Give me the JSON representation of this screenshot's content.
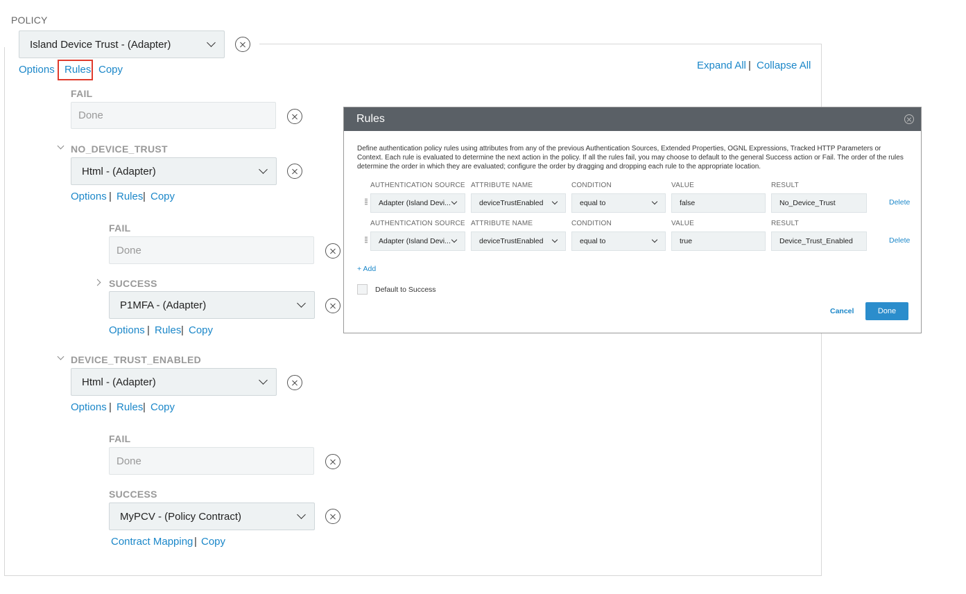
{
  "policy_label": "POLICY",
  "root": {
    "select": "Island Device Trust - (Adapter)",
    "links": {
      "options": "Options",
      "rules": "Rules",
      "copy": "Copy"
    },
    "expand_all": "Expand All",
    "sep": "|",
    "collapse_all": "Collapse All"
  },
  "fail1": {
    "label": "FAIL",
    "value": "Done"
  },
  "no_device_trust": {
    "label": "NO_DEVICE_TRUST",
    "select": "Html - (Adapter)",
    "links": {
      "options": "Options",
      "rules": "Rules",
      "copy": "Copy"
    },
    "fail": {
      "label": "FAIL",
      "value": "Done"
    },
    "success": {
      "label": "SUCCESS",
      "select": "P1MFA - (Adapter)",
      "links": {
        "options": "Options",
        "rules": "Rules",
        "copy": "Copy"
      }
    }
  },
  "device_trust_enabled": {
    "label": "DEVICE_TRUST_ENABLED",
    "select": "Html - (Adapter)",
    "links": {
      "options": "Options",
      "rules": "Rules",
      "copy": "Copy"
    },
    "fail": {
      "label": "FAIL",
      "value": "Done"
    },
    "success": {
      "label": "SUCCESS",
      "select": "MyPCV - (Policy Contract)",
      "links": {
        "contract_mapping": "Contract Mapping",
        "copy": "Copy"
      }
    }
  },
  "modal": {
    "title": "Rules",
    "description": "Define authentication policy rules using attributes from any of the previous Authentication Sources, Extended Properties, OGNL Expressions, Tracked HTTP Parameters or Context. Each rule is evaluated to determine the next action in the policy. If all the rules fail, you may choose to default to the general Success action or Fail. The order of the rules determine the order in which they are evaluated; configure the order by dragging and dropping each rule to the appropriate location.",
    "columns": {
      "source": "AUTHENTICATION SOURCE",
      "attribute": "ATTRIBUTE NAME",
      "condition": "CONDITION",
      "value": "VALUE",
      "result": "RESULT"
    },
    "rows": [
      {
        "source": "Adapter (Island Devi...",
        "attribute": "deviceTrustEnabled",
        "condition": "equal to",
        "value": "false",
        "result": "No_Device_Trust",
        "delete": "Delete"
      },
      {
        "source": "Adapter (Island Devi...",
        "attribute": "deviceTrustEnabled",
        "condition": "equal to",
        "value": "true",
        "result": "Device_Trust_Enabled",
        "delete": "Delete"
      }
    ],
    "add": "+ Add",
    "default_label": "Default to Success",
    "cancel": "Cancel",
    "done": "Done"
  }
}
